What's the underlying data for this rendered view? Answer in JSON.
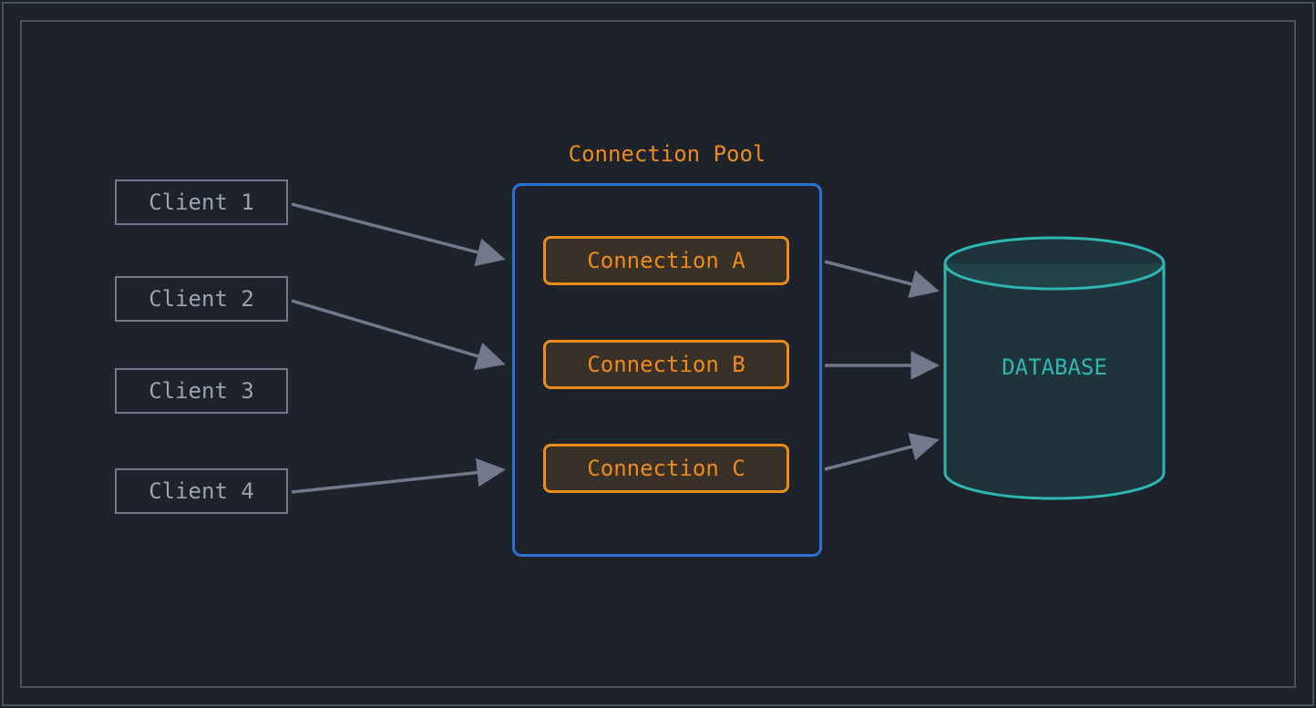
{
  "clients": [
    "Client 1",
    "Client 2",
    "Client 3",
    "Client 4"
  ],
  "pool_title": "Connection Pool",
  "connections": [
    "Connection A",
    "Connection B",
    "Connection C"
  ],
  "database_label": "DATABASE",
  "colors": {
    "background": "#1d222b",
    "frame": "#4a5160",
    "client_border": "#707a8c",
    "client_text": "#9aa3b2",
    "pool_border": "#2a72d4",
    "accent_orange": "#ed8b1c",
    "conn_fill": "rgba(237,139,28,0.14)",
    "arrow": "#707a8c",
    "teal": "#2fb7b2",
    "db_fill": "rgba(47,183,178,0.12)"
  }
}
